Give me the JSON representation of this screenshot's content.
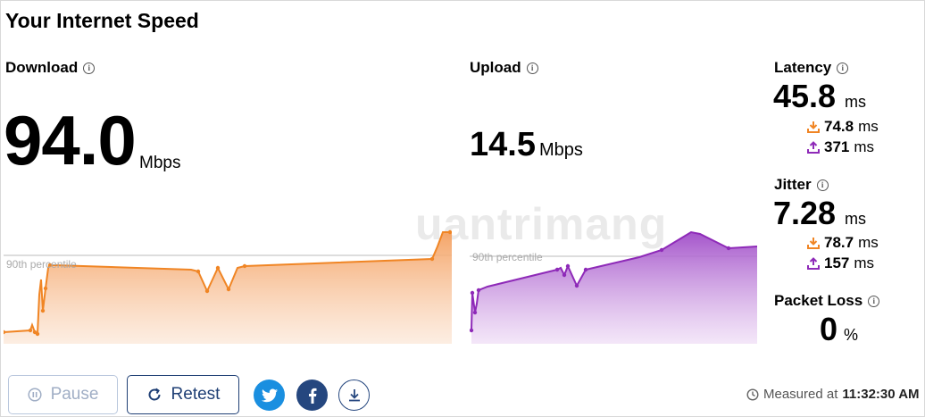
{
  "title": "Your Internet Speed",
  "download": {
    "label": "Download",
    "value": "94.0",
    "unit": "Mbps",
    "percentile_label": "90th percentile"
  },
  "upload": {
    "label": "Upload",
    "value": "14.5",
    "unit": "Mbps",
    "percentile_label": "90th percentile"
  },
  "latency": {
    "label": "Latency",
    "value": "45.8",
    "unit": "ms",
    "down_value": "74.8",
    "down_unit": "ms",
    "up_value": "371",
    "up_unit": "ms"
  },
  "jitter": {
    "label": "Jitter",
    "value": "7.28",
    "unit": "ms",
    "down_value": "78.7",
    "down_unit": "ms",
    "up_value": "157",
    "up_unit": "ms"
  },
  "packet_loss": {
    "label": "Packet Loss",
    "value": "0",
    "unit": "%"
  },
  "buttons": {
    "pause": "Pause",
    "retest": "Retest"
  },
  "measured": {
    "prefix": "Measured at",
    "time": "11:32:30 AM"
  },
  "watermark": "uantrimang",
  "colors": {
    "download": "#f08524",
    "upload": "#8e2ab8",
    "navy": "#1f3f75",
    "twitter": "#1a8fe0",
    "facebook": "#25477f"
  },
  "icons": [
    "info-icon",
    "pause-icon",
    "retest-icon",
    "twitter-icon",
    "facebook-icon",
    "download-icon",
    "clock-icon",
    "download-arrow-icon",
    "upload-arrow-icon"
  ]
}
